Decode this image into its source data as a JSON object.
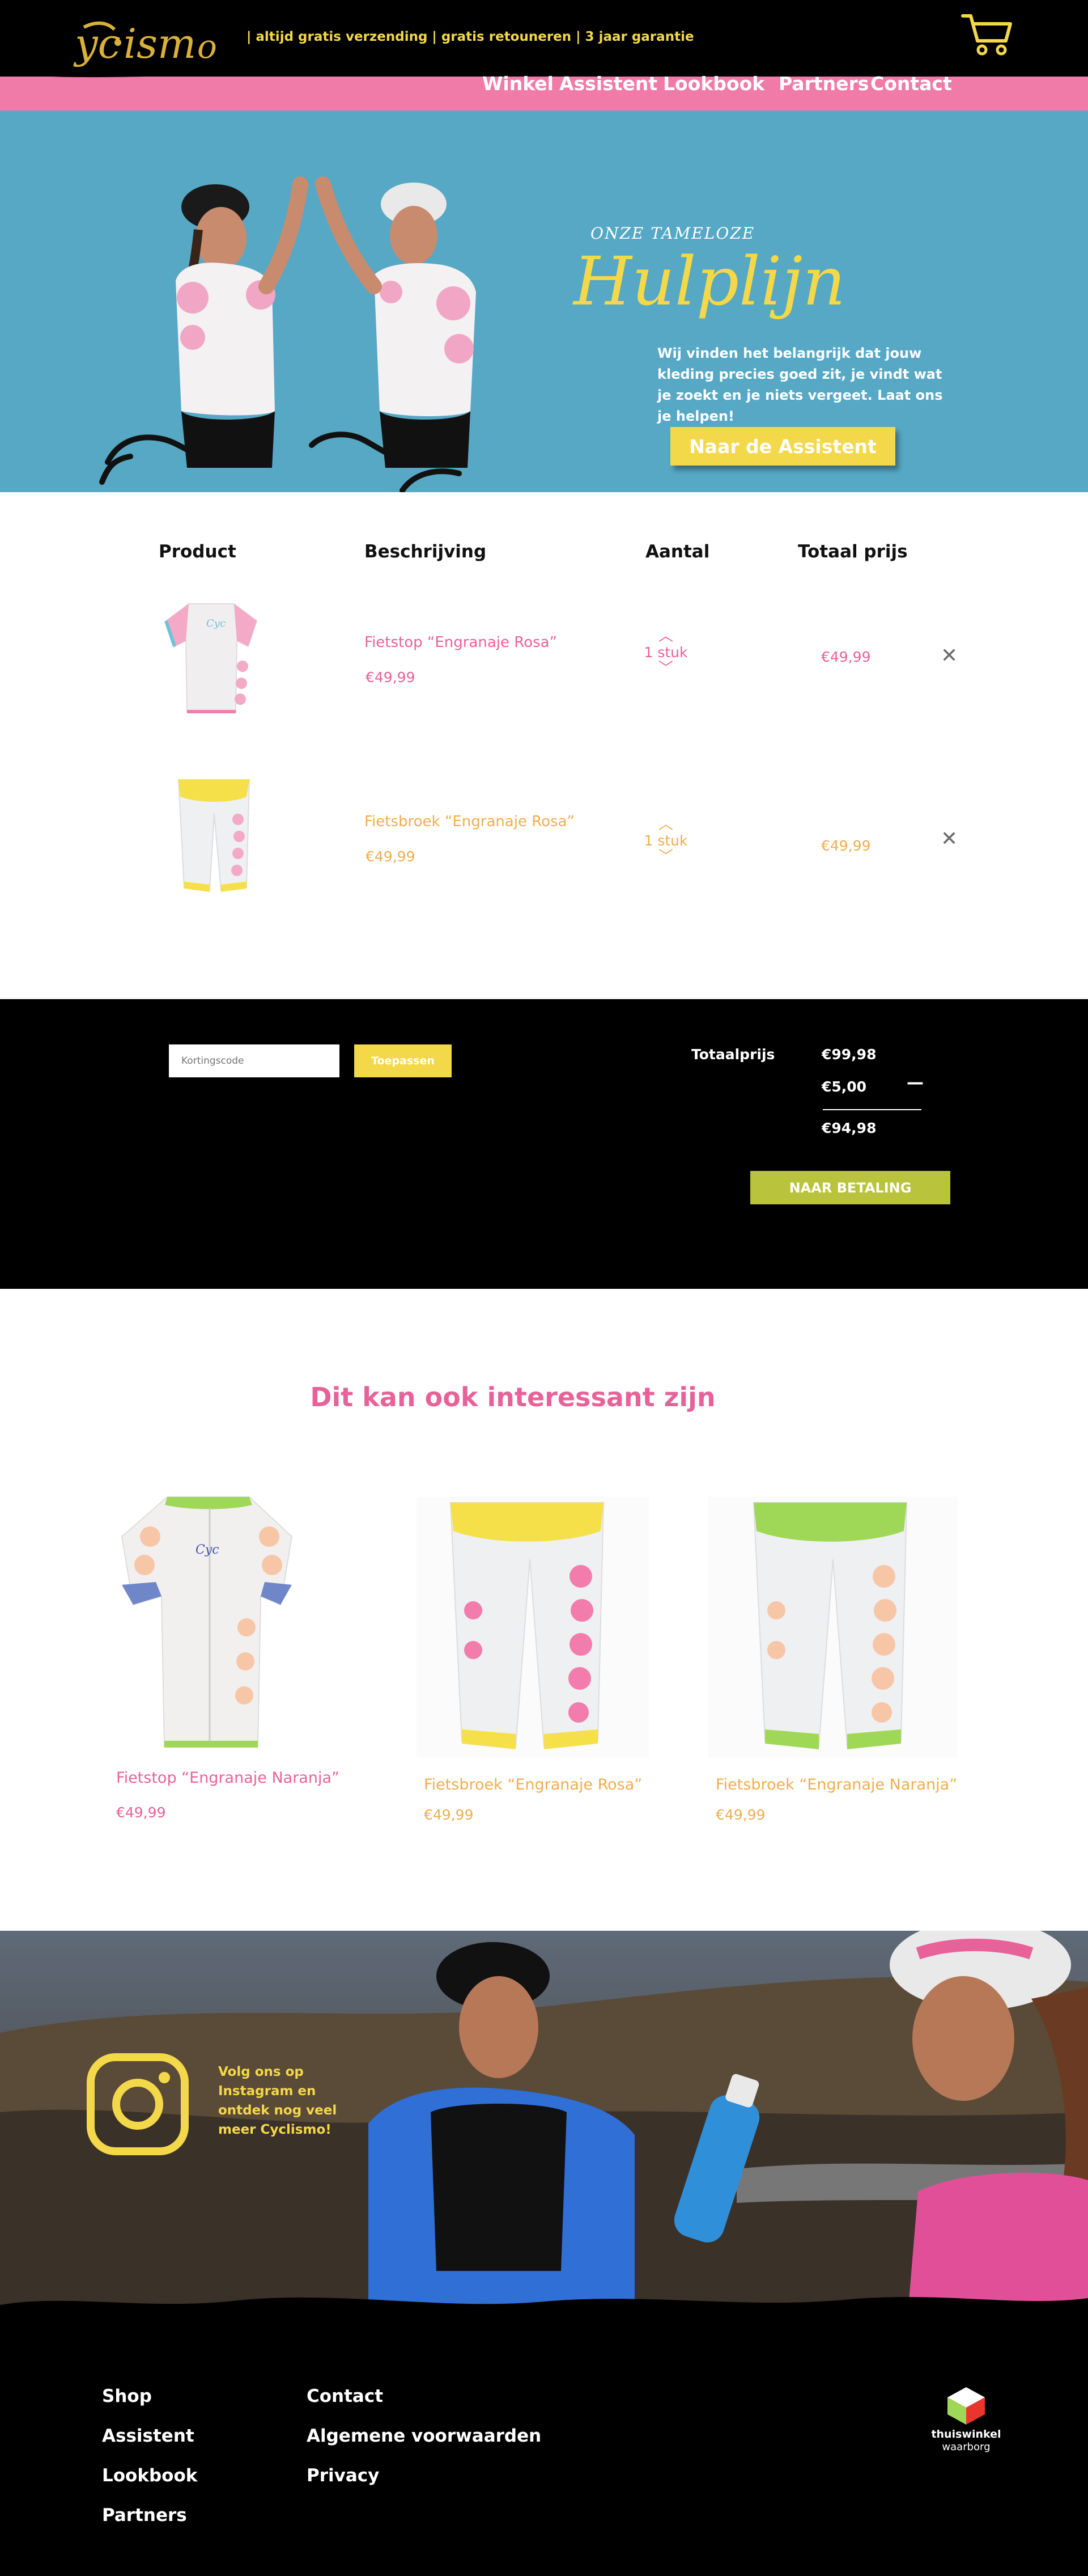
{
  "header": {
    "logo_alt": "Cyclismo",
    "tagline": "| altijd gratis verzending | gratis retouneren | 3 jaar garantie",
    "cart_icon": "shopping-cart-icon",
    "nav": [
      "Winkel",
      "Assistent",
      "Lookbook",
      "Partners",
      "Contact"
    ]
  },
  "hero": {
    "kicker": "ONZE TAMELOZE",
    "title": "Hulplijn",
    "text": "Wij vinden het belangrijk dat jouw kleding precies goed zit, je vindt wat je zoekt en je niets vergeet. Laat ons je helpen!",
    "button": "Naar de Assistent"
  },
  "cart": {
    "headers": {
      "product": "Product",
      "description": "Beschrijving",
      "quantity": "Aantal",
      "total": "Totaal prijs"
    },
    "items": [
      {
        "name": "Fietstop “Engranaje Rosa”",
        "price": "€49,99",
        "quantity": "1 stuk",
        "total": "€49,99",
        "color": "#e8629a"
      },
      {
        "name": "Fietsbroek “Engranaje Rosa”",
        "price": "€49,99",
        "quantity": "1 stuk",
        "total": "€49,99",
        "color": "#f1ad4e"
      }
    ],
    "remove_icon": "close-icon"
  },
  "totals": {
    "coupon_placeholder": "Kortingscode",
    "apply": "Toepassen",
    "label": "Totaalprijs",
    "subtotal": "€99,98",
    "discount": "€5,00",
    "minus": "—",
    "total": "€94,98",
    "pay": "NAAR BETALING"
  },
  "suggestions": {
    "title": "Dit kan ook interessant zijn",
    "items": [
      {
        "name": "Fietstop “Engranaje Naranja”",
        "price": "€49,99"
      },
      {
        "name": "Fietsbroek “Engranaje Rosa”",
        "price": "€49,99"
      },
      {
        "name": "Fietsbroek “Engranaje Naranja”",
        "price": "€49,99"
      }
    ]
  },
  "instagram": {
    "text": "Volg ons op Instagram en ontdek nog veel meer Cyclismo!",
    "icon": "instagram-icon"
  },
  "footer": {
    "col1": [
      "Shop",
      "Assistent",
      "Lookbook",
      "Partners"
    ],
    "col2": [
      "Contact",
      "Algemene voorwaarden",
      "Privacy"
    ],
    "trust_name": "thuiswinkel",
    "trust_sub": "waarborg"
  },
  "colors": {
    "pink": "#f07aa8",
    "yellow": "#f3d84a",
    "blue": "#56a8c5",
    "green": "#b9c33b",
    "black": "#000000"
  }
}
